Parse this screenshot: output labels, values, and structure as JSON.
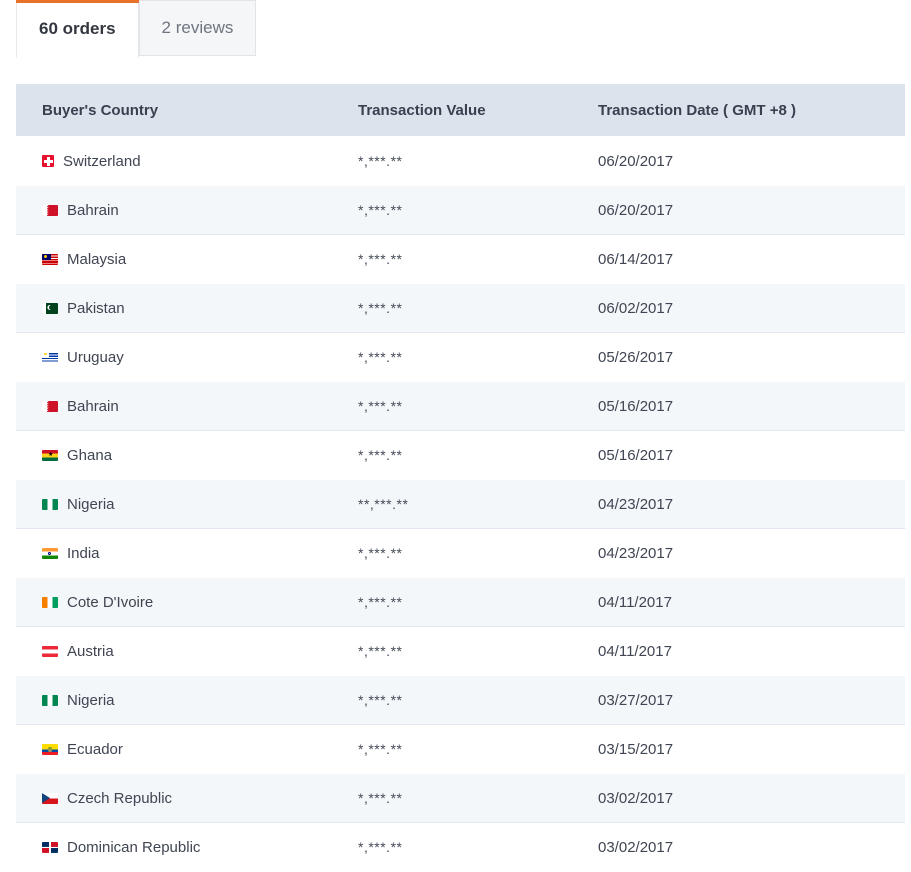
{
  "tabs": [
    {
      "label": "60 orders",
      "active": true
    },
    {
      "label": "2 reviews",
      "active": false
    }
  ],
  "table": {
    "headers": {
      "country": "Buyer's Country",
      "value": "Transaction Value",
      "date": "Transaction Date ( GMT +8 )"
    },
    "rows": [
      {
        "country": "Switzerland",
        "flag": "switzerland",
        "value": "*,***.**",
        "date": "06/20/2017"
      },
      {
        "country": "Bahrain",
        "flag": "bahrain",
        "value": "*,***.**",
        "date": "06/20/2017"
      },
      {
        "country": "Malaysia",
        "flag": "malaysia",
        "value": "*,***.**",
        "date": "06/14/2017"
      },
      {
        "country": "Pakistan",
        "flag": "pakistan",
        "value": "*,***.**",
        "date": "06/02/2017"
      },
      {
        "country": "Uruguay",
        "flag": "uruguay",
        "value": "*,***.**",
        "date": "05/26/2017"
      },
      {
        "country": "Bahrain",
        "flag": "bahrain",
        "value": "*,***.**",
        "date": "05/16/2017"
      },
      {
        "country": "Ghana",
        "flag": "ghana",
        "value": "*,***.**",
        "date": "05/16/2017"
      },
      {
        "country": "Nigeria",
        "flag": "nigeria",
        "value": "**,***.**",
        "date": "04/23/2017"
      },
      {
        "country": "India",
        "flag": "india",
        "value": "*,***.**",
        "date": "04/23/2017"
      },
      {
        "country": "Cote D'Ivoire",
        "flag": "cotedivoire",
        "value": "*,***.**",
        "date": "04/11/2017"
      },
      {
        "country": "Austria",
        "flag": "austria",
        "value": "*,***.**",
        "date": "04/11/2017"
      },
      {
        "country": "Nigeria",
        "flag": "nigeria",
        "value": "*,***.**",
        "date": "03/27/2017"
      },
      {
        "country": "Ecuador",
        "flag": "ecuador",
        "value": "*,***.**",
        "date": "03/15/2017"
      },
      {
        "country": "Czech Republic",
        "flag": "czech",
        "value": "*,***.**",
        "date": "03/02/2017"
      },
      {
        "country": "Dominican Republic",
        "flag": "dominican",
        "value": "*,***.**",
        "date": "03/02/2017"
      }
    ]
  },
  "colors": {
    "accent": "#e8722a",
    "header_bg": "#dde3ec",
    "stripe_bg": "#f4f7fa"
  }
}
